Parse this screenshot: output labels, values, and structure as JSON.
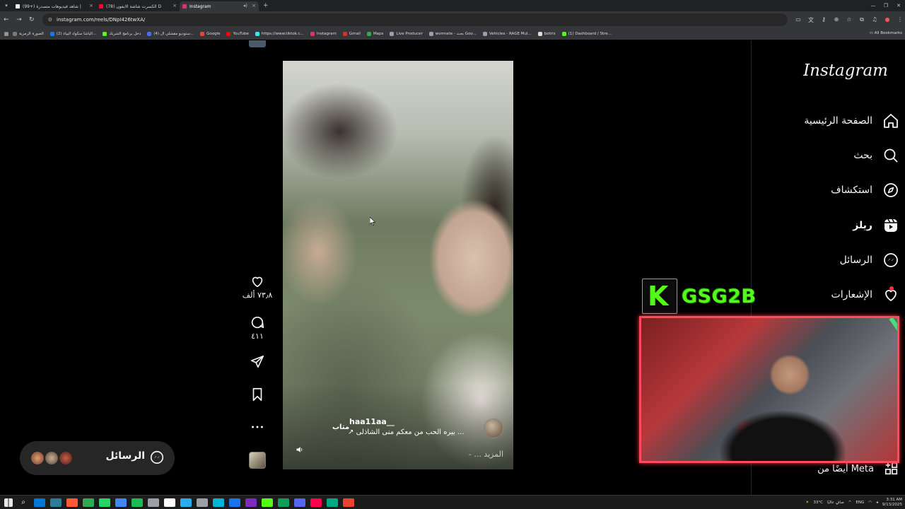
{
  "browser": {
    "tabs": [
      {
        "label": "(99+) شاهد فيديوهات متصدرة |",
        "color": "#f0f0f0",
        "active": false
      },
      {
        "label": "(78) الكسرت شاشة الايفون D",
        "color": "#ff0033",
        "active": false
      },
      {
        "label": "Instagram",
        "color": "#e1306c",
        "active": true
      }
    ],
    "new_tab": "+",
    "url": "instagram.com/reels/DNpI426twXA/",
    "bookmarks": [
      {
        "label": "الصورة الرمزية",
        "color": "#7a7a7a"
      },
      {
        "label": "(2) الياشا سكواد اليياء...",
        "color": "#1877f2"
      },
      {
        "label": "دخل برنامج الشريك",
        "color": "#53fc18"
      },
      {
        "label": "(4) ستوديو مقشلي ال...",
        "color": "#4a6cf7"
      },
      {
        "label": "Google",
        "color": "#ea4335"
      },
      {
        "label": "YouTube",
        "color": "#ff0000"
      },
      {
        "label": "https://www.tiktok.c...",
        "color": "#25f4ee"
      },
      {
        "label": "Instagram",
        "color": "#e1306c"
      },
      {
        "label": "Gmail",
        "color": "#d93025"
      },
      {
        "label": "Maps",
        "color": "#34a853"
      },
      {
        "label": "Live Producer",
        "color": "#9aa0a6"
      },
      {
        "label": "wormate - بحث Goo...",
        "color": "#9aa0a6"
      },
      {
        "label": "Vehicles - RAGE Mul...",
        "color": "#9aa0a6"
      },
      {
        "label": "botrix",
        "color": "#dddddd"
      },
      {
        "label": "(1) Dashboard / Stre...",
        "color": "#53fc18"
      }
    ],
    "all_bookmarks": "All Bookmarks"
  },
  "sidebar": {
    "logo": "Instagram",
    "items": [
      {
        "label": "الصفحة الرئيسية",
        "icon": "home-icon"
      },
      {
        "label": "بحث",
        "icon": "search-icon"
      },
      {
        "label": "استكشاف",
        "icon": "compass-icon"
      },
      {
        "label": "ريلز",
        "icon": "reels-icon"
      },
      {
        "label": "الرسائل",
        "icon": "messenger-icon"
      },
      {
        "label": "الإشعارات",
        "icon": "heart-icon"
      }
    ],
    "meta_label": "أيضًا من Meta"
  },
  "reel": {
    "username": "haa11aa__",
    "follow": "متاب",
    "caption": "↗ بيره الحب من معكم منى الشاذلى ...",
    "more": "- ... المزيد",
    "likes": "٧٣٫٨ ألف",
    "comments": "٤١١"
  },
  "messages_pill": {
    "label": "الرسائل"
  },
  "stream": {
    "logo_letter": "K",
    "name": "GSG2B",
    "brand_color": "#53fc18",
    "frame_color": "#ff4b5c"
  },
  "taskbar": {
    "weather": "33°C",
    "weather_text": "صافٍ عاليًا",
    "lang": "ENG",
    "time": "3:31 AM",
    "date": "9/13/2025",
    "apps": [
      "#0078d4",
      "#2d7d9a",
      "#ff5a36",
      "#34a853",
      "#25d366",
      "#4285f4",
      "#1db954",
      "#9aa0a6",
      "#ffffff",
      "#2aabee",
      "#9aa0a6",
      "#00b4d8",
      "#1a73e8",
      "#7b2cbf",
      "#53fc18",
      "#0f9d58",
      "#5865f2",
      "#ff0050",
      "#00a884",
      "#ea4335"
    ]
  }
}
